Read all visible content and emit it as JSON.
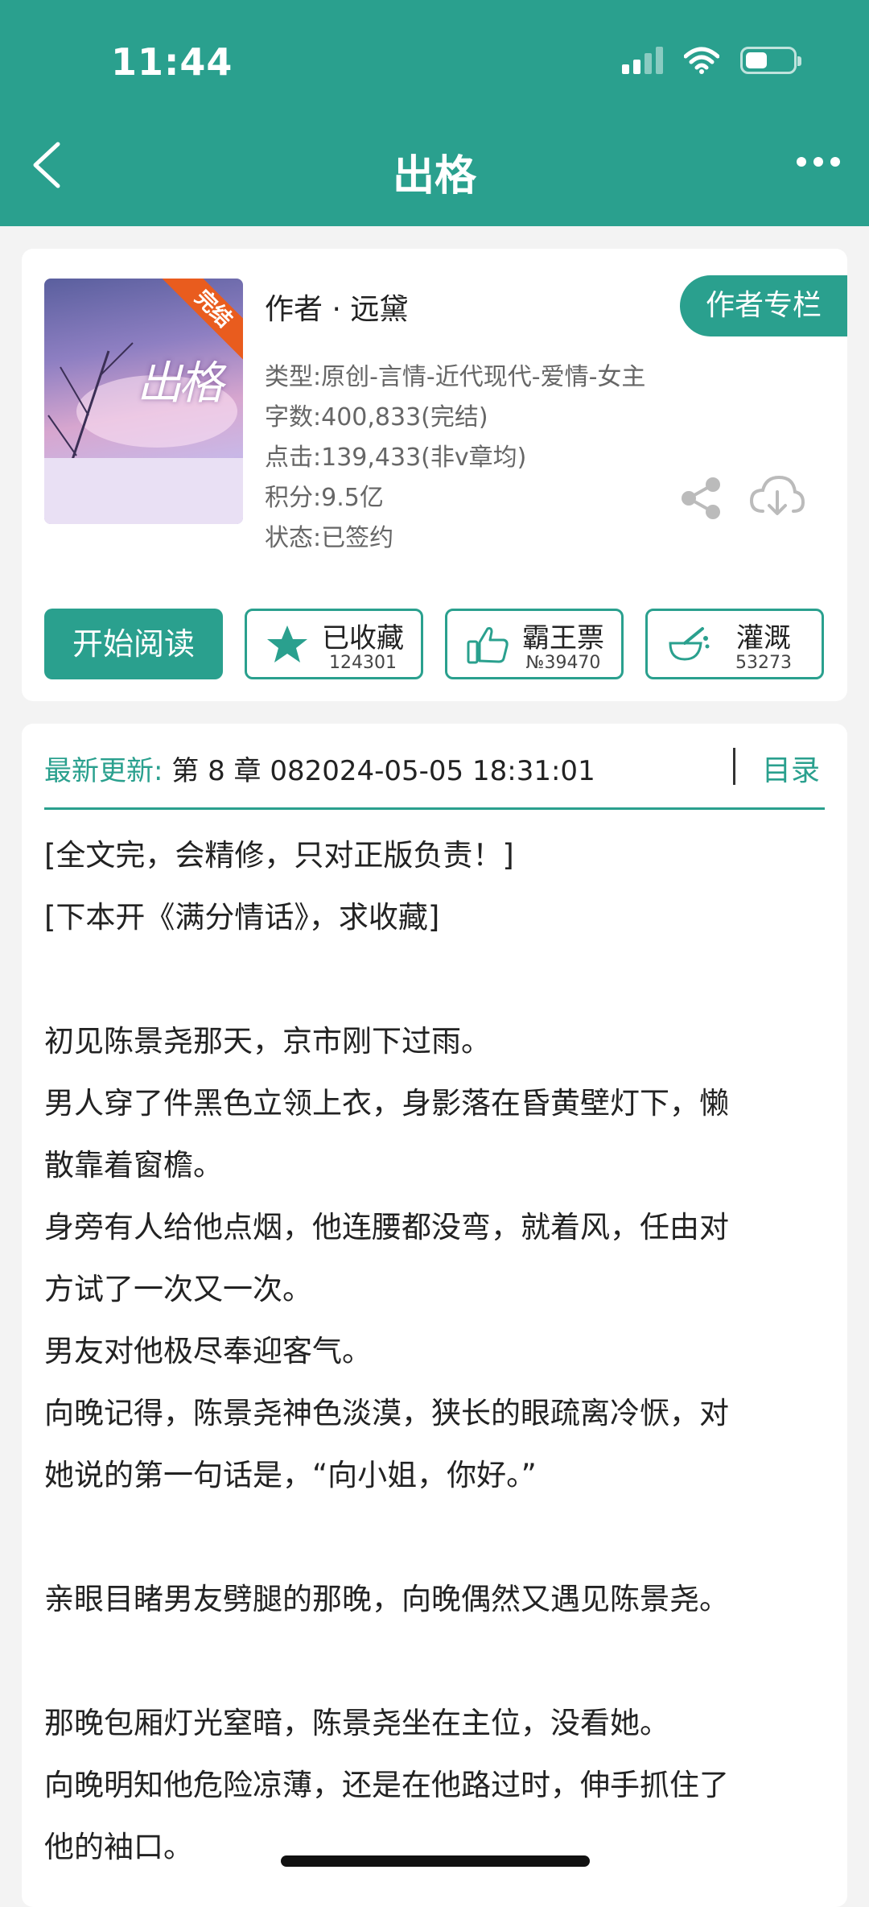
{
  "status_bar": {
    "time": "11:44"
  },
  "nav": {
    "title": "出格"
  },
  "book": {
    "cover_title": "出格",
    "cover_badge": "完结",
    "author_line": "作者 · 远黛",
    "author_column_label": "作者专栏",
    "type": "类型:原创-言情-近代现代-爱情-女主",
    "word_count": "字数:400,833(完结)",
    "clicks": "点击:139,433(非v章均)",
    "score": "积分:9.5亿",
    "status": "状态:已签约"
  },
  "actions": {
    "read_label": "开始阅读",
    "collect": {
      "label": "已收藏",
      "count": "124301"
    },
    "vote": {
      "label": "霸王票",
      "count": "№39470"
    },
    "water": {
      "label": "灌溉",
      "count": "53273"
    }
  },
  "update": {
    "label": "最新更新:",
    "value": " 第 8 章 082024-05-05 18:31:01",
    "catalog_label": "目录"
  },
  "description": [
    "[全文完，会精修，只对正版负责！]",
    "[下本开《满分情话》，求收藏]",
    "",
    "初见陈景尧那天，京市刚下过雨。",
    "男人穿了件黑色立领上衣，身影落在昏黄壁灯下，懒",
    "散靠着窗檐。",
    "身旁有人给他点烟，他连腰都没弯，就着风，任由对",
    "方试了一次又一次。",
    "男友对他极尽奉迎客气。",
    "向晚记得，陈景尧神色淡漠，狭长的眼疏离冷恹，对",
    "她说的第一句话是，“向小姐，你好。”",
    "",
    "亲眼目睹男友劈腿的那晚，向晚偶然又遇见陈景尧。",
    "",
    "那晚包厢灯光窒暗，陈景尧坐在主位，没看她。",
    "向晚明知他危险凉薄，还是在他路过时，伸手抓住了",
    "他的袖口。"
  ]
}
